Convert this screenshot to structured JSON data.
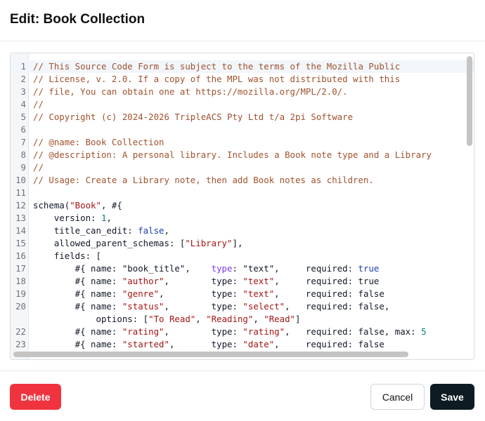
{
  "dialog": {
    "title": "Edit: Book Collection"
  },
  "editor": {
    "lines": [
      {
        "num": "1",
        "tokens": [
          {
            "t": "// This Source Code Form is subject to the terms of the Mozilla Public",
            "c": "c"
          }
        ]
      },
      {
        "num": "2",
        "tokens": [
          {
            "t": "// License, v. 2.0. If a copy of the MPL was not distributed with this",
            "c": "c"
          }
        ]
      },
      {
        "num": "3",
        "tokens": [
          {
            "t": "// file, You can obtain one at https://mozilla.org/MPL/2.0/.",
            "c": "c"
          }
        ]
      },
      {
        "num": "4",
        "tokens": [
          {
            "t": "//",
            "c": "c"
          }
        ]
      },
      {
        "num": "5",
        "tokens": [
          {
            "t": "// Copyright (c) 2024-2026 TripleACS Pty Ltd t/a 2pi Software",
            "c": "c"
          }
        ]
      },
      {
        "num": "6",
        "tokens": []
      },
      {
        "num": "7",
        "tokens": [
          {
            "t": "// @name: Book Collection",
            "c": "c"
          }
        ]
      },
      {
        "num": "8",
        "tokens": [
          {
            "t": "// @description: A personal library. Includes a Book note type and a Library",
            "c": "c"
          }
        ]
      },
      {
        "num": "9",
        "tokens": [
          {
            "t": "//",
            "c": "c"
          }
        ]
      },
      {
        "num": "10",
        "tokens": [
          {
            "t": "// Usage: Create a Library note, then add Book notes as children.",
            "c": "c"
          }
        ]
      },
      {
        "num": "11",
        "tokens": []
      },
      {
        "num": "12",
        "tokens": [
          {
            "t": "schema(",
            "c": "fn"
          },
          {
            "t": "\"Book\"",
            "c": "s"
          },
          {
            "t": ", #{",
            "c": "fn"
          }
        ]
      },
      {
        "num": "13",
        "tokens": [
          {
            "t": "    version: ",
            "c": "fn"
          },
          {
            "t": "1",
            "c": "n"
          },
          {
            "t": ",",
            "c": "fn"
          }
        ]
      },
      {
        "num": "14",
        "tokens": [
          {
            "t": "    title_can_edit: ",
            "c": "fn"
          },
          {
            "t": "false",
            "c": "k"
          },
          {
            "t": ",",
            "c": "fn"
          }
        ]
      },
      {
        "num": "15",
        "tokens": [
          {
            "t": "    allowed_parent_schemas: [",
            "c": "fn"
          },
          {
            "t": "\"Library\"",
            "c": "s"
          },
          {
            "t": "],",
            "c": "fn"
          }
        ]
      },
      {
        "num": "16",
        "tokens": [
          {
            "t": "    fields: [",
            "c": "fn"
          }
        ]
      },
      {
        "num": "17",
        "tokens": [
          {
            "t": "        #{ name: \"book_title\",    ",
            "c": "fn"
          },
          {
            "t": "type",
            "c": "p"
          },
          {
            "t": ": \"text\",     required: ",
            "c": "fn"
          },
          {
            "t": "true",
            "c": "k"
          }
        ]
      },
      {
        "num": "18",
        "tokens": [
          {
            "t": "        #{ name: ",
            "c": "fn"
          },
          {
            "t": "\"author\"",
            "c": "s"
          },
          {
            "t": ",        type: ",
            "c": "fn"
          },
          {
            "t": "\"text\"",
            "c": "s"
          },
          {
            "t": ",     required: true",
            "c": "fn"
          }
        ]
      },
      {
        "num": "19",
        "tokens": [
          {
            "t": "        #{ name: ",
            "c": "fn"
          },
          {
            "t": "\"genre\"",
            "c": "s"
          },
          {
            "t": ",         type: ",
            "c": "fn"
          },
          {
            "t": "\"text\"",
            "c": "s"
          },
          {
            "t": ",     required: false",
            "c": "fn"
          }
        ]
      },
      {
        "num": "20",
        "tokens": [
          {
            "t": "        #{ name: ",
            "c": "fn"
          },
          {
            "t": "\"status\"",
            "c": "s"
          },
          {
            "t": ",        type: ",
            "c": "fn"
          },
          {
            "t": "\"select\"",
            "c": "s"
          },
          {
            "t": ",   required: false,",
            "c": "fn"
          }
        ]
      },
      {
        "num": "",
        "tokens": [
          {
            "t": "            options: [",
            "c": "fn"
          },
          {
            "t": "\"To Read\"",
            "c": "s"
          },
          {
            "t": ", ",
            "c": "fn"
          },
          {
            "t": "\"Reading\"",
            "c": "s"
          },
          {
            "t": ", ",
            "c": "fn"
          },
          {
            "t": "\"Read\"",
            "c": "s"
          },
          {
            "t": "]",
            "c": "fn"
          }
        ]
      },
      {
        "num": "22",
        "tokens": [
          {
            "t": "        #{ name: ",
            "c": "fn"
          },
          {
            "t": "\"rating\"",
            "c": "s"
          },
          {
            "t": ",        type: ",
            "c": "fn"
          },
          {
            "t": "\"rating\"",
            "c": "s"
          },
          {
            "t": ",   required: false, max: ",
            "c": "fn"
          },
          {
            "t": "5",
            "c": "n"
          }
        ]
      },
      {
        "num": "23",
        "tokens": [
          {
            "t": "        #{ name: ",
            "c": "fn"
          },
          {
            "t": "\"started\"",
            "c": "s"
          },
          {
            "t": ",       type: ",
            "c": "fn"
          },
          {
            "t": "\"date\"",
            "c": "s"
          },
          {
            "t": ",     required: false",
            "c": "fn"
          }
        ]
      }
    ]
  },
  "footer": {
    "delete_label": "Delete",
    "cancel_label": "Cancel",
    "save_label": "Save"
  },
  "colors": {
    "delete": "#f0343f",
    "save": "#0d1b22",
    "comment": "#a0522d",
    "string": "#a31515"
  }
}
